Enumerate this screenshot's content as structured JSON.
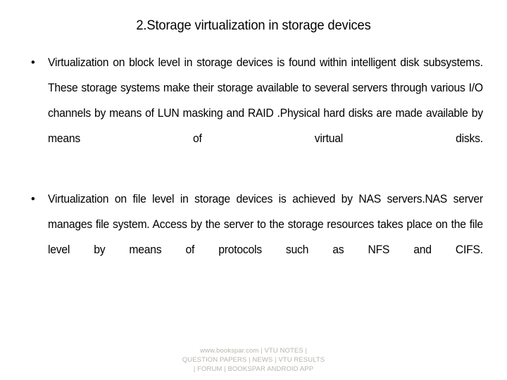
{
  "slide": {
    "title": "2.Storage virtualization in storage devices",
    "bullet_marker": "•",
    "bullets": [
      {
        "text": "Virtualization on block level in storage devices is found within intelligent disk subsystems. These storage systems make their storage available to several servers through various I/O channels by means of LUN masking and RAID .Physical hard disks are made available by means of virtual disks."
      },
      {
        "text": "Virtualization on file level in storage devices is achieved by NAS servers.NAS server manages file system. Access by the server to the storage resources takes place on the file level by means of protocols such as NFS and CIFS."
      }
    ]
  },
  "footer": {
    "line1": "www.bookspar.com | VTU NOTES |",
    "line2": "QUESTION PAPERS | NEWS | VTU RESULTS",
    "line3": "| FORUM | BOOKSPAR ANDROID APP",
    "color": "#b9b4ac"
  },
  "colors": {
    "background": "#ffffff",
    "text": "#000000",
    "footer_text": "#b9b4ac"
  }
}
